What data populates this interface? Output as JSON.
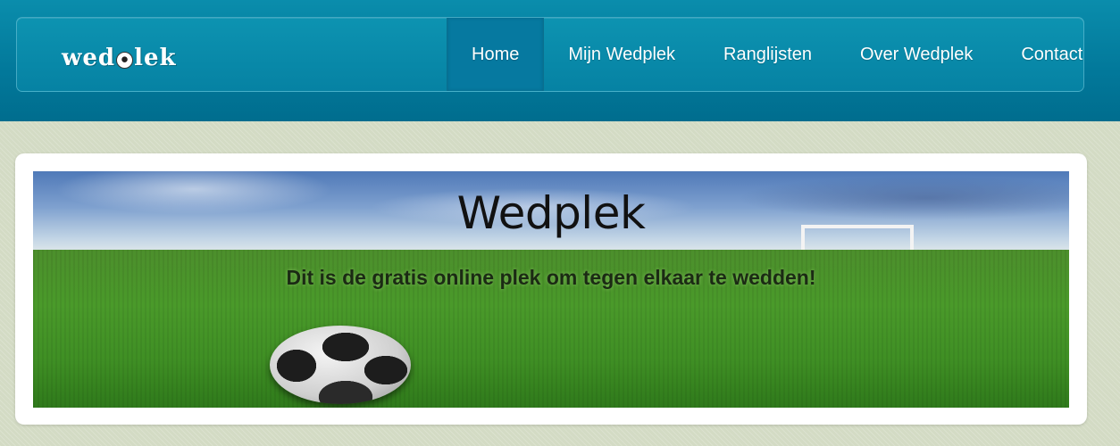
{
  "header": {
    "logo": {
      "text_before": "wed",
      "text_after": "lek",
      "icon": "soccer-ball-icon"
    },
    "nav": [
      {
        "label": "Home",
        "active": true
      },
      {
        "label": "Mijn Wedplek",
        "active": false
      },
      {
        "label": "Ranglijsten",
        "active": false
      },
      {
        "label": "Over Wedplek",
        "active": false
      },
      {
        "label": "Contact",
        "active": false
      }
    ]
  },
  "hero": {
    "title": "Wedplek",
    "subtitle": "Dit is de gratis online plek om tegen elkaar te wedden!"
  },
  "colors": {
    "header_bg": "#02789a",
    "navbar_bg": "#0682a3",
    "nav_active_bg": "#0679a0",
    "page_bg": "#d3dbc4",
    "card_bg": "#ffffff"
  }
}
